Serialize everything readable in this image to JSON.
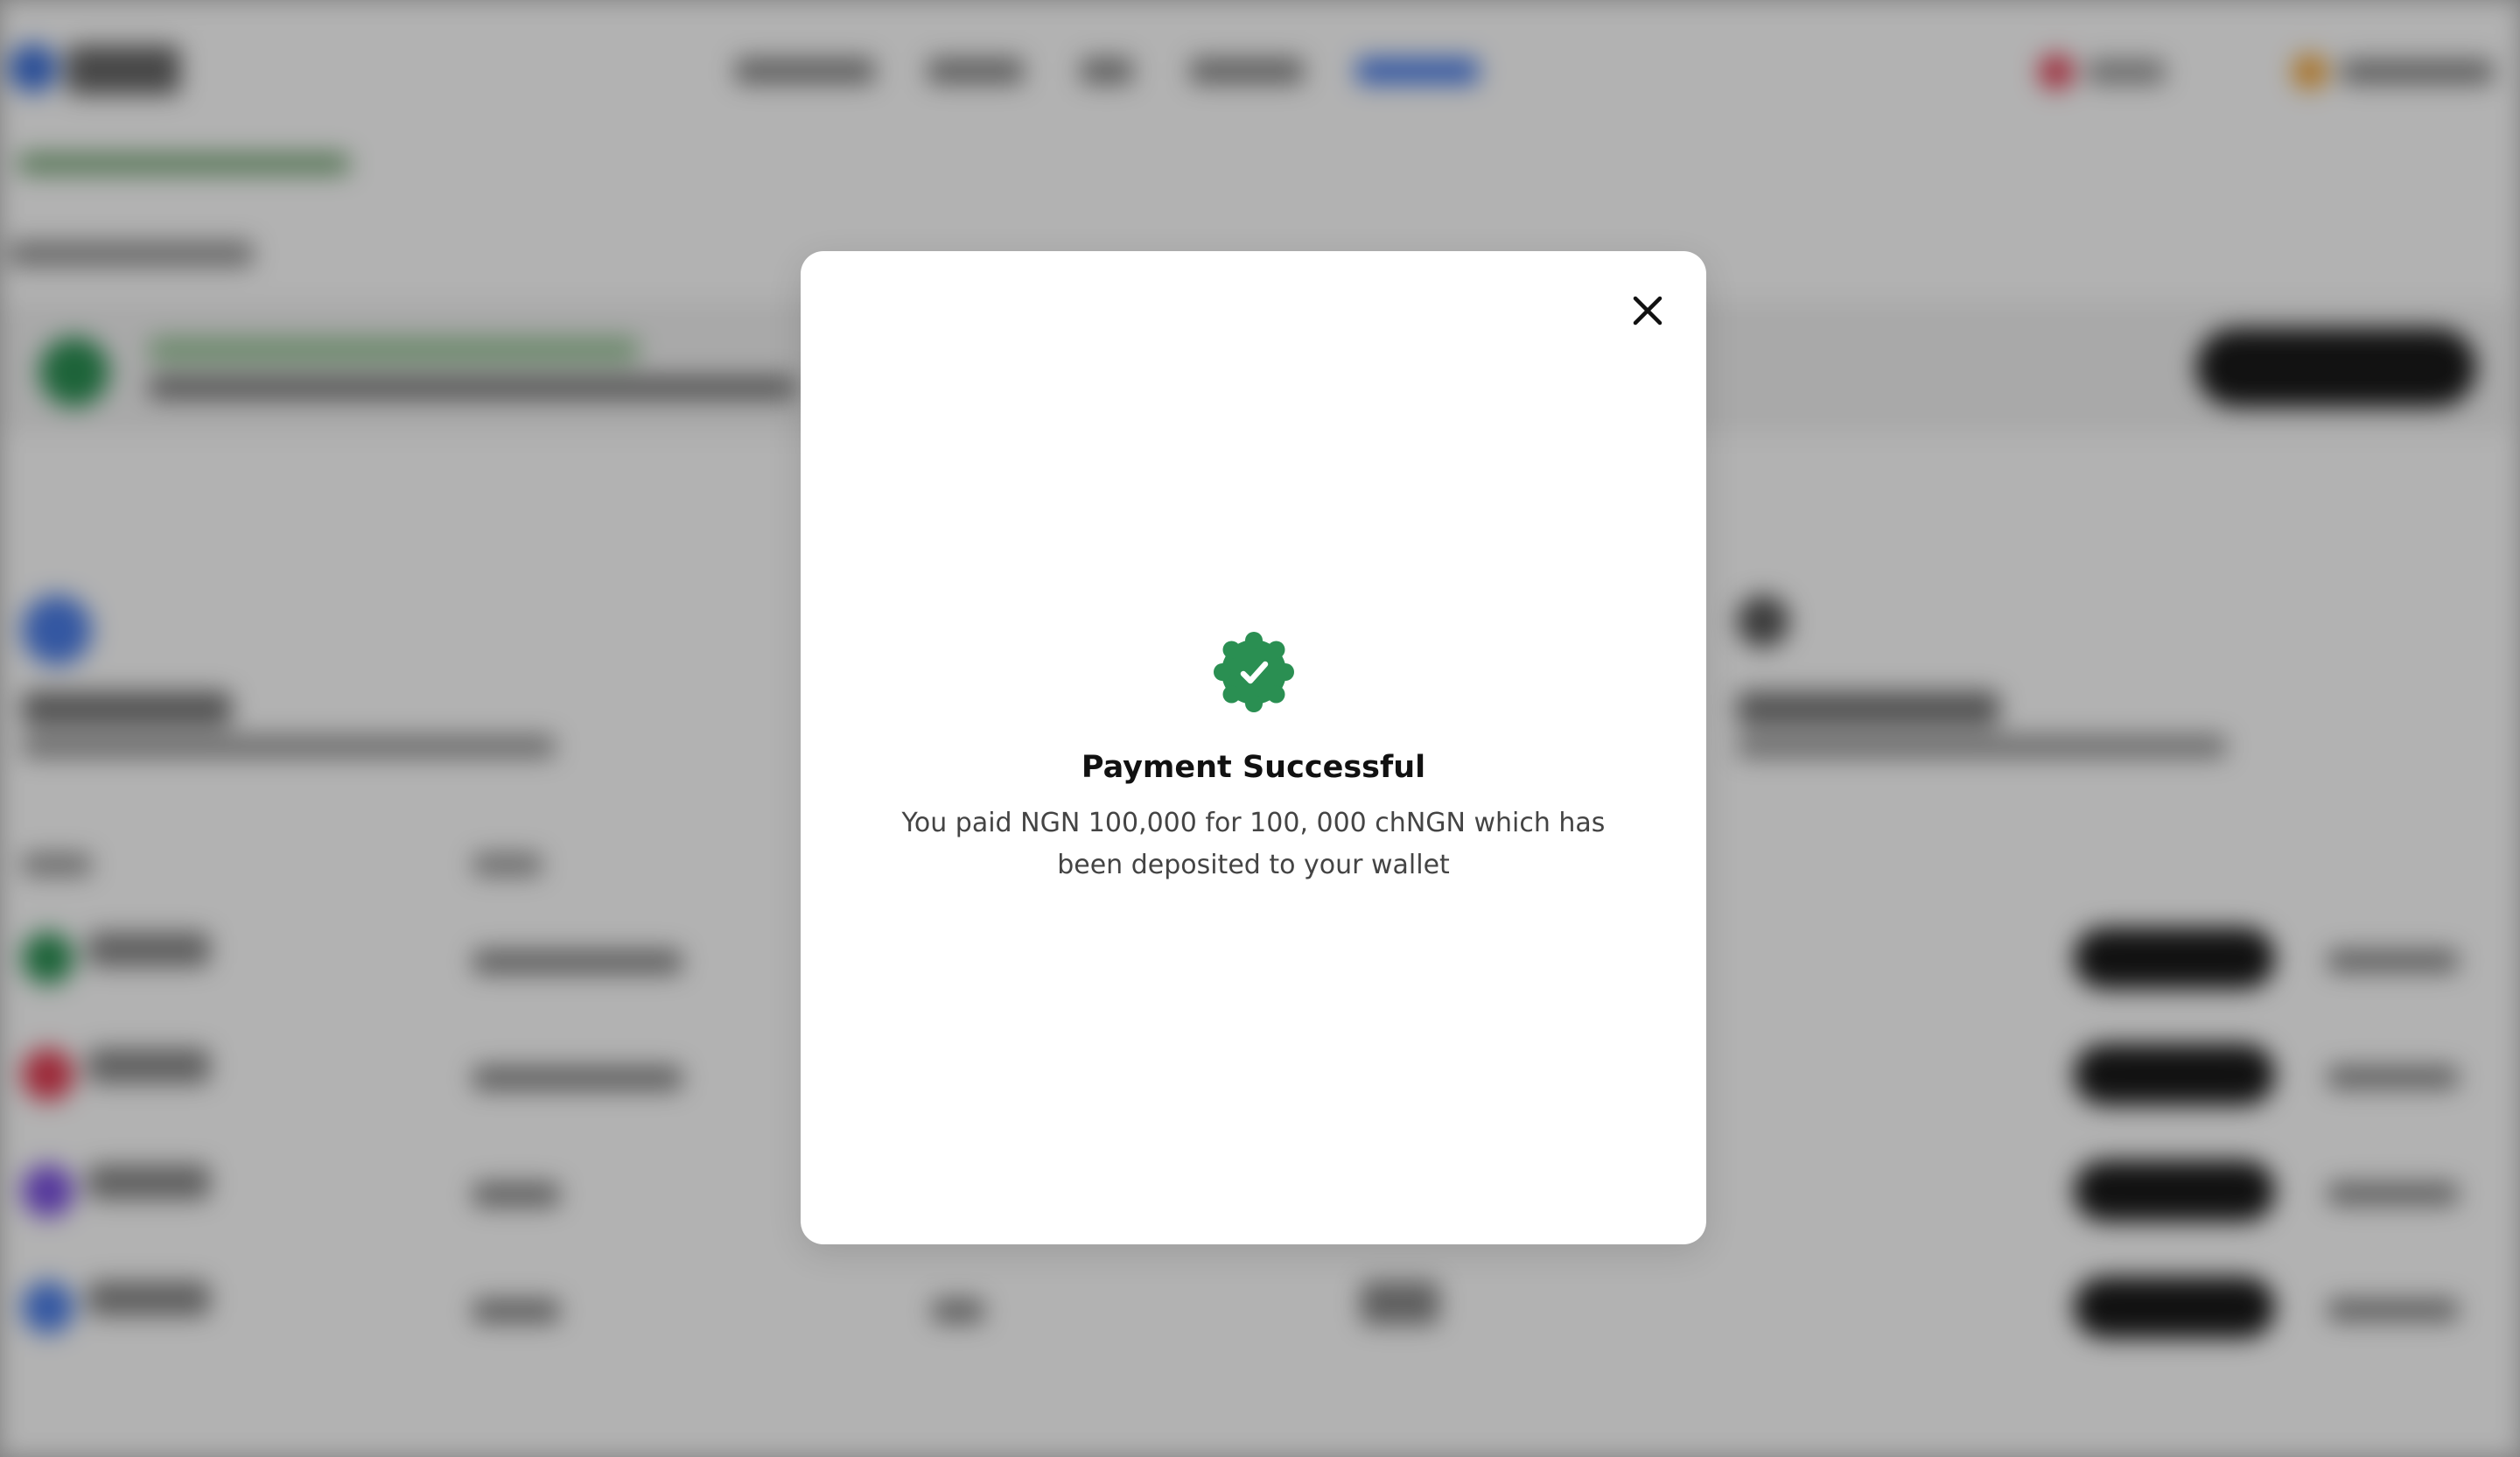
{
  "modal": {
    "title": "Payment Successful",
    "message": "You paid NGN 100,000 for 100, 000 chNGN which has been deposited to your wallet",
    "close_icon": "close-icon",
    "status_icon": "verified-check-badge-icon",
    "accent_color": "#2a8f52"
  },
  "background": {
    "state": "blurred",
    "overlay_color": "rgba(0,0,0,0.30)"
  }
}
